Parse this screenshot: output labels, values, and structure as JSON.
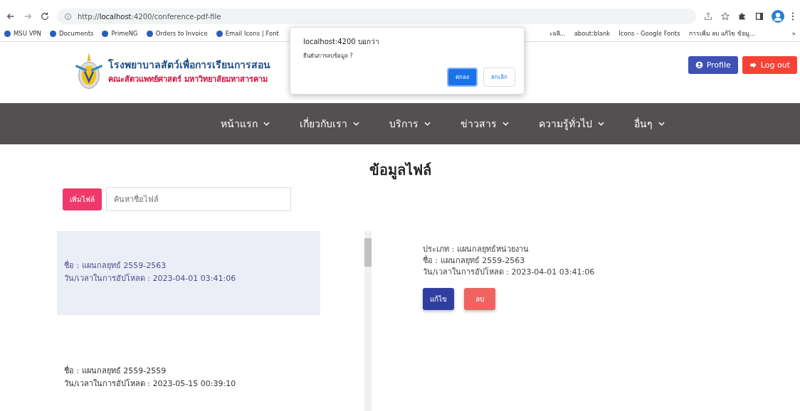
{
  "browser": {
    "url_prefix": "http://",
    "url_host": "localhost",
    "url_rest": ":4200/conference-pdf-file",
    "bookmarks_left": [
      "MSU VPN",
      "Documents",
      "PrimeNG",
      "Orders to Invoice",
      "Email Icons | Font"
    ],
    "bookmarks_right": [
      "ะผลิ...",
      "about:blank",
      "Icons - Google Fonts",
      "การเพิ่ม ลบ แก้ไข ข้อมู..."
    ],
    "more": "»"
  },
  "dialog": {
    "title": "localhost:4200 บอกว่า",
    "message": "ยืนยันการลบข้อมูล ?",
    "ok": "ตกลง",
    "cancel": "ยกเลิก"
  },
  "header": {
    "title": "โรงพยาบาลสัตว์เพื่อการเรียนการสอน",
    "subtitle": "คณะสัตวแพทย์ศาสตร์ มหาวิทยาลัยมหาสารคาม",
    "profile": "Profile",
    "logout": "Log out"
  },
  "nav": [
    "หน้าแรก",
    "เกี่ยวกับเรา",
    "บริการ",
    "ข่าวสาร",
    "ความรู้ทั่วไป",
    "อื่นๆ"
  ],
  "page_title": "ข้อมูลไฟล์",
  "add_button": "เพิ่มไฟล์",
  "search": {
    "placeholder": "ค้นหาชื่อไฟล์"
  },
  "files": [
    {
      "name": "ชื่อ : แผนกลยุทธ์ 2559-2563",
      "uploaded": "วัน/เวลาในการอัปโหลด : 2023-04-01 03:41:06",
      "selected": true
    },
    {
      "name": "ชื่อ : แผนกลยุทธ์ 2559-2559",
      "uploaded": "วัน/เวลาในการอัปโหลด : 2023-05-15 00:39:10",
      "selected": false
    }
  ],
  "detail": {
    "type": "ประเภท : แผนกลยุทธ์หน่วยงาน",
    "name": "ชื่อ : แผนกลยุทธ์ 2559-2563",
    "uploaded": "วัน/เวลาในการอัปโหลด : 2023-04-01 03:41:06",
    "edit": "แก้ไข",
    "delete": "ลบ"
  }
}
